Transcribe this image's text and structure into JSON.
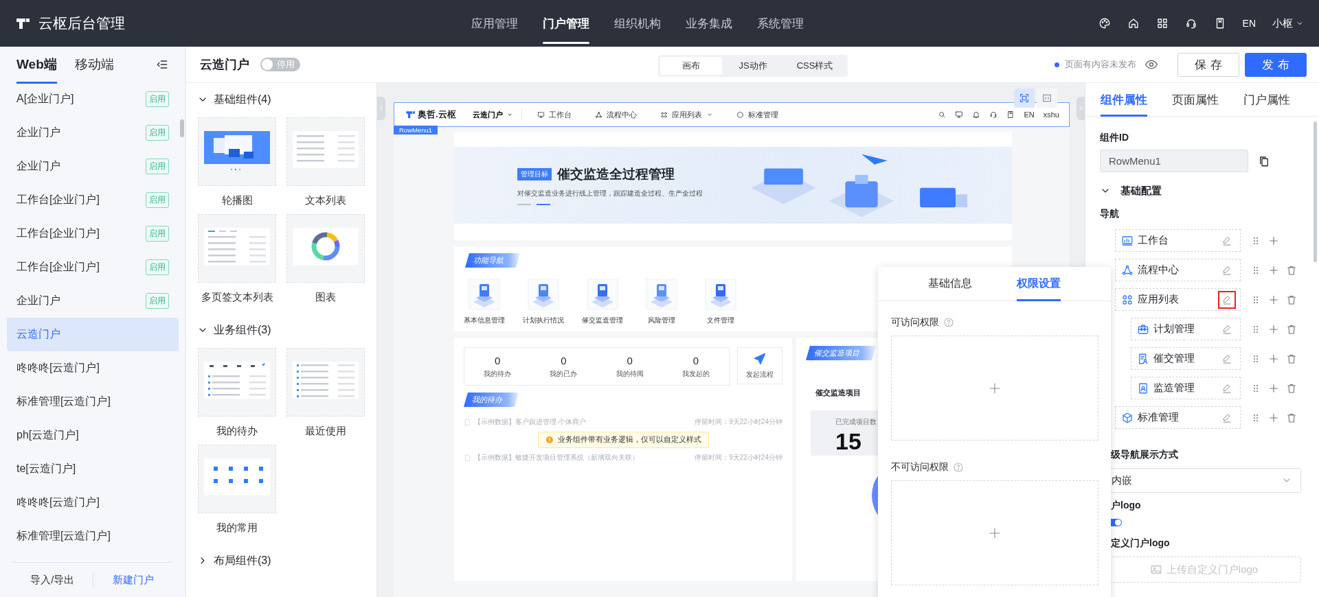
{
  "topbar": {
    "title": "云枢后台管理",
    "nav": [
      {
        "label": "应用管理",
        "selected": false
      },
      {
        "label": "门户管理",
        "selected": true
      },
      {
        "label": "组织机构",
        "selected": false
      },
      {
        "label": "业务集成",
        "selected": false
      },
      {
        "label": "系统管理",
        "selected": false
      }
    ],
    "lang": "EN",
    "user": "小枢"
  },
  "sidebar": {
    "tabs": [
      {
        "label": "Web端",
        "selected": true
      },
      {
        "label": "移动端",
        "selected": false
      }
    ],
    "items": [
      {
        "label": "A[企业门户]",
        "badge": "启用",
        "selected": false
      },
      {
        "label": "企业门户",
        "badge": "启用",
        "selected": false
      },
      {
        "label": "企业门户",
        "badge": "启用",
        "selected": false
      },
      {
        "label": "工作台[企业门户]",
        "badge": "启用",
        "selected": false
      },
      {
        "label": "工作台[企业门户]",
        "badge": "启用",
        "selected": false
      },
      {
        "label": "工作台[企业门户]",
        "badge": "启用",
        "selected": false
      },
      {
        "label": "企业门户",
        "badge": "启用",
        "selected": false
      },
      {
        "label": "云造门户",
        "selected": true
      },
      {
        "label": "咚咚咚[云造门户]",
        "selected": false
      },
      {
        "label": "标准管理[云造门户]",
        "selected": false
      },
      {
        "label": "ph[云造门户]",
        "selected": false
      },
      {
        "label": "te[云造门户]",
        "selected": false
      },
      {
        "label": "咚咚咚[云造门户]",
        "selected": false
      },
      {
        "label": "标准管理[云造门户]",
        "selected": false
      }
    ],
    "footer": {
      "import": "导入/导出",
      "create": "新建门户"
    }
  },
  "header": {
    "title": "云造门户",
    "toggle": {
      "on": false,
      "label": "停用"
    },
    "modes": [
      {
        "label": "画布",
        "selected": true
      },
      {
        "label": "JS动作",
        "selected": false
      },
      {
        "label": "CSS样式",
        "selected": false
      }
    ],
    "status": "页面有内容未发布",
    "save": "保存",
    "publish": "发布"
  },
  "palette": {
    "groups": [
      {
        "title": "基础组件(4)",
        "expanded": true,
        "items": [
          {
            "label": "轮播图",
            "kind": "carousel"
          },
          {
            "label": "文本列表",
            "kind": "text-list"
          },
          {
            "label": "多页签文本列表",
            "kind": "tabbed-list"
          },
          {
            "label": "图表",
            "kind": "chart"
          }
        ]
      },
      {
        "title": "业务组件(3)",
        "expanded": true,
        "items": [
          {
            "label": "我的待办",
            "kind": "todo"
          },
          {
            "label": "最近使用",
            "kind": "recent"
          },
          {
            "label": "我的常用",
            "kind": "favorites"
          }
        ]
      },
      {
        "title": "布局组件(3)",
        "expanded": false
      }
    ]
  },
  "canvas": {
    "toolbar": [
      {
        "kind": "fit",
        "selected": true
      },
      {
        "kind": "split",
        "selected": false
      }
    ],
    "preview": {
      "logo": "奥哲.云枢",
      "site": "云造门户",
      "nav": [
        {
          "label": "工作台",
          "kind": "monitor",
          "dropdown": false
        },
        {
          "label": "流程中心",
          "kind": "nodes",
          "dropdown": false
        },
        {
          "label": "应用列表",
          "kind": "apps",
          "dropdown": true
        },
        {
          "label": "标准管理",
          "kind": "hexagon",
          "dropdown": false
        }
      ],
      "lang": "EN",
      "user": "xshu",
      "tag": "RowMenu1"
    },
    "banner": {
      "tag": "管理目标",
      "title": "催交监造全过程管理",
      "subtitle": "对催交监造业务进行线上管理，跟踪建造全过程、生产全过程"
    },
    "function_nav": {
      "title": "功能导航",
      "items": [
        "基本信息管理",
        "计划执行情况",
        "催交监造管理",
        "风险管理",
        "文件管理"
      ]
    },
    "stats": [
      {
        "value": "0",
        "label": "我的待办"
      },
      {
        "value": "0",
        "label": "我的已办"
      },
      {
        "value": "0",
        "label": "我的待阅"
      },
      {
        "value": "0",
        "label": "我发起的"
      }
    ],
    "start_flow": "发起流程",
    "todo": {
      "title": "我的待办",
      "rows": [
        {
          "text": "【示例数据】客户跟进管理-个体商户",
          "time": "停留时间：9天22小时24分钟"
        },
        {
          "text": "【示例数据】敏捷开发项目管理系统（新增双向关联）",
          "time": "停留时间：9天22小时24分钟"
        }
      ]
    },
    "notice": "业务组件带有业务逻辑，仅可以自定义样式",
    "project": {
      "badge": "催交监造项目",
      "title": "催交监造项目",
      "metric_label": "已完成项目数",
      "metric_value": "15"
    }
  },
  "properties": {
    "tabs": [
      {
        "label": "组件属性",
        "selected": true
      },
      {
        "label": "页面属性",
        "selected": false
      },
      {
        "label": "门户属性",
        "selected": false
      }
    ],
    "id_label": "组件ID",
    "id_value": "RowMenu1",
    "section": {
      "title": "基础配置",
      "expanded": true
    },
    "nav_label": "导航",
    "nav": [
      {
        "label": "工作台",
        "kind": "dashboard",
        "deletable": false,
        "highlighted": false
      },
      {
        "label": "流程中心",
        "kind": "nodes",
        "deletable": true,
        "highlighted": false
      },
      {
        "label": "应用列表",
        "kind": "apps",
        "deletable": true,
        "highlighted": true,
        "children": [
          {
            "label": "计划管理",
            "kind": "toolbox",
            "deletable": true,
            "highlighted": false
          },
          {
            "label": "催交管理",
            "kind": "doc-user",
            "deletable": true,
            "highlighted": false
          },
          {
            "label": "监造管理",
            "kind": "badge-user",
            "deletable": true,
            "highlighted": false
          }
        ]
      },
      {
        "label": "标准管理",
        "kind": "cube",
        "deletable": true,
        "highlighted": false
      }
    ],
    "sub_nav_label": "级导航展示方式",
    "sub_nav_value": "内嵌",
    "logo_label": "户logo",
    "logo_toggle": {
      "on": true
    },
    "custom_logo_label": "定义门户logo",
    "upload": "上传自定义门户logo"
  },
  "popover": {
    "tabs": [
      {
        "label": "基础信息",
        "selected": false
      },
      {
        "label": "权限设置",
        "selected": true
      }
    ],
    "sections": [
      {
        "label": "可访问权限"
      },
      {
        "label": "不可访问权限"
      }
    ]
  }
}
